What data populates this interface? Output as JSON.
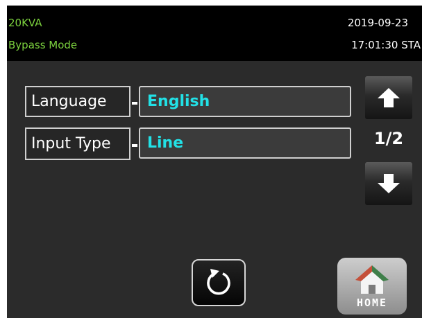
{
  "header": {
    "model": "20KVA",
    "mode": "Bypass Mode",
    "date": "2019-09-23",
    "time": "17:01:30 STA"
  },
  "settings": [
    {
      "label": "Language",
      "value": "English"
    },
    {
      "label": "Input Type",
      "value": "Line"
    }
  ],
  "pagination": {
    "indicator": "1/2",
    "up_icon": "arrow-up-icon",
    "down_icon": "arrow-down-icon"
  },
  "footer": {
    "refresh_icon": "refresh-icon",
    "home_label": "HOME",
    "home_icon": "house-icon"
  },
  "colors": {
    "background": "#2b2b2b",
    "header_background": "#000000",
    "model_text": "#7cd23e",
    "value_text": "#22e1e6",
    "frame_border": "#cfcfcf",
    "roof_red": "#c4503a",
    "roof_green": "#3f7f4a"
  }
}
